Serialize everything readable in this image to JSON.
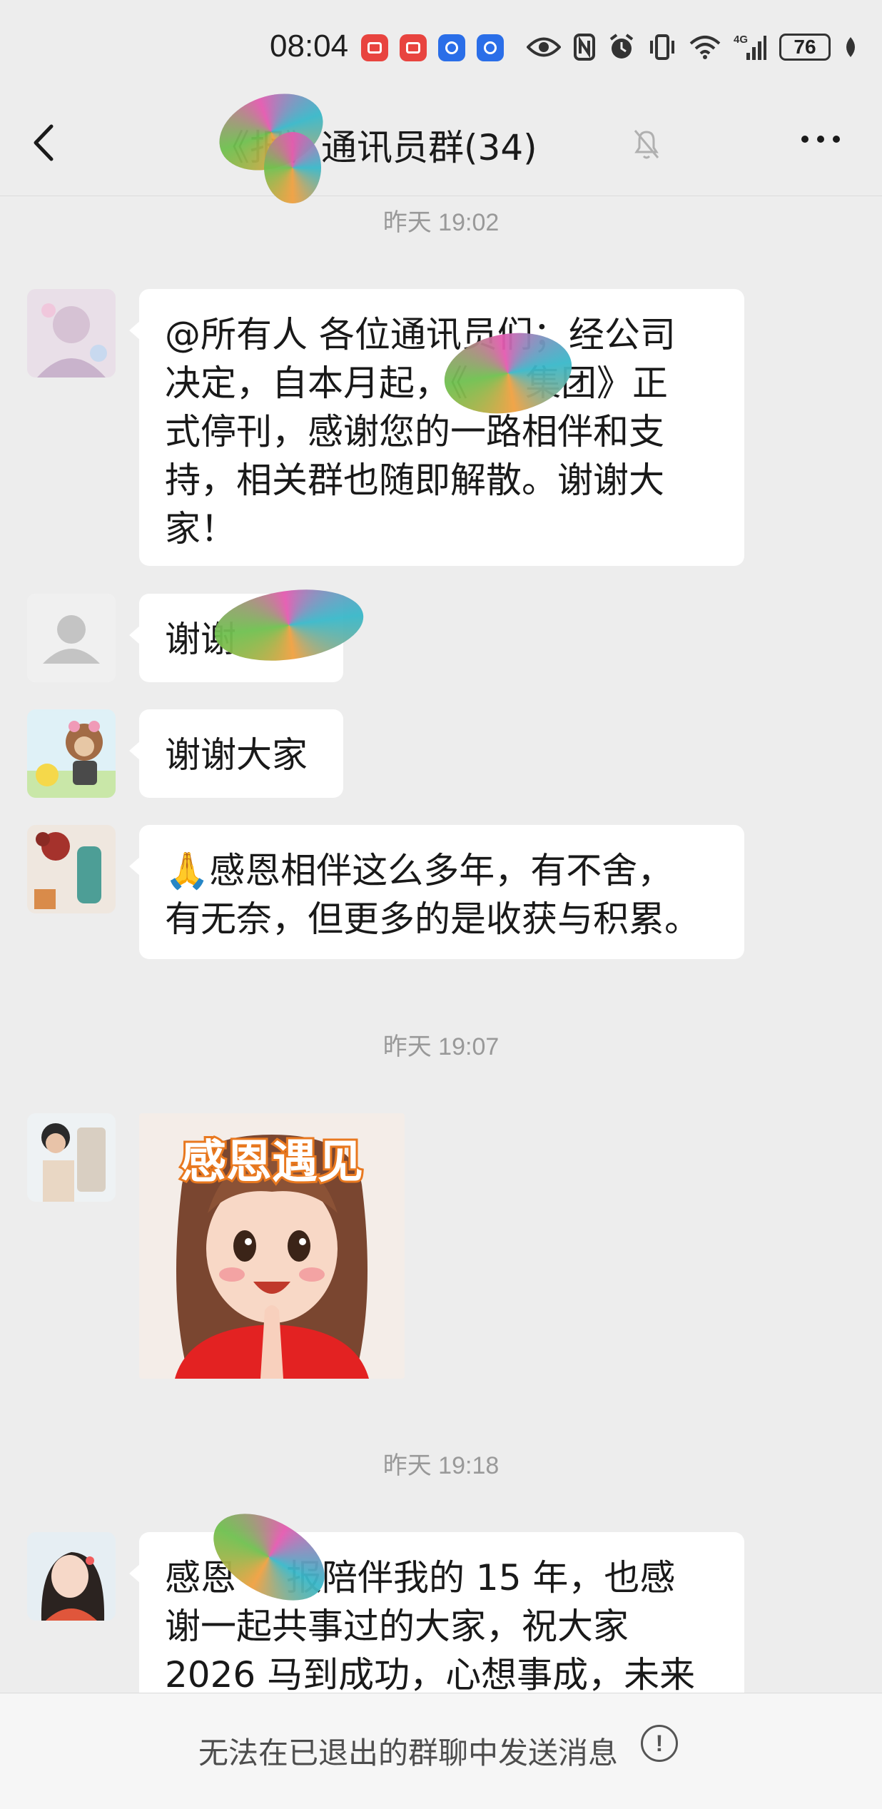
{
  "status_bar": {
    "time": "08:04",
    "network": "4G",
    "battery": "76"
  },
  "header": {
    "title": "《报》通讯员群(34)",
    "back_icon": "chevron-left-icon",
    "mute_icon": "bell-off-icon",
    "more_icon": "ellipsis-icon"
  },
  "messages": [
    {
      "type": "timestamp",
      "text": "昨天 19:02"
    },
    {
      "type": "text",
      "lines": [
        "@所有人  各位通讯员们；经公司",
        "决定，自本月起，《",
        "集团》正",
        "式停刊，感谢您的一路相伴和支",
        "持，相关群也随即解散。谢谢大",
        "家！"
      ]
    },
    {
      "type": "text",
      "lines": [
        "谢谢"
      ]
    },
    {
      "type": "text",
      "lines": [
        "谢谢大家"
      ]
    },
    {
      "type": "text",
      "lines": [
        "🙏感恩相伴这么多年，有不舍，",
        "有无奈，但更多的是收获与积累。"
      ]
    },
    {
      "type": "timestamp",
      "text": "昨天 19:07"
    },
    {
      "type": "sticker",
      "caption": "感恩遇见"
    },
    {
      "type": "timestamp",
      "text": "昨天 19:18"
    },
    {
      "type": "text",
      "lines": [
        "感恩",
        "报陪伴我的 15 年，也感",
        "谢一起共事过的大家，祝大家",
        "2026 马到成功，心想事成，未来"
      ]
    }
  ],
  "bottom_bar": {
    "notice": "无法在已退出的群聊中发送消息",
    "info_glyph": "!"
  },
  "colors": {
    "background": "#ededed",
    "bubble": "#ffffff",
    "timestamp": "#999999"
  }
}
